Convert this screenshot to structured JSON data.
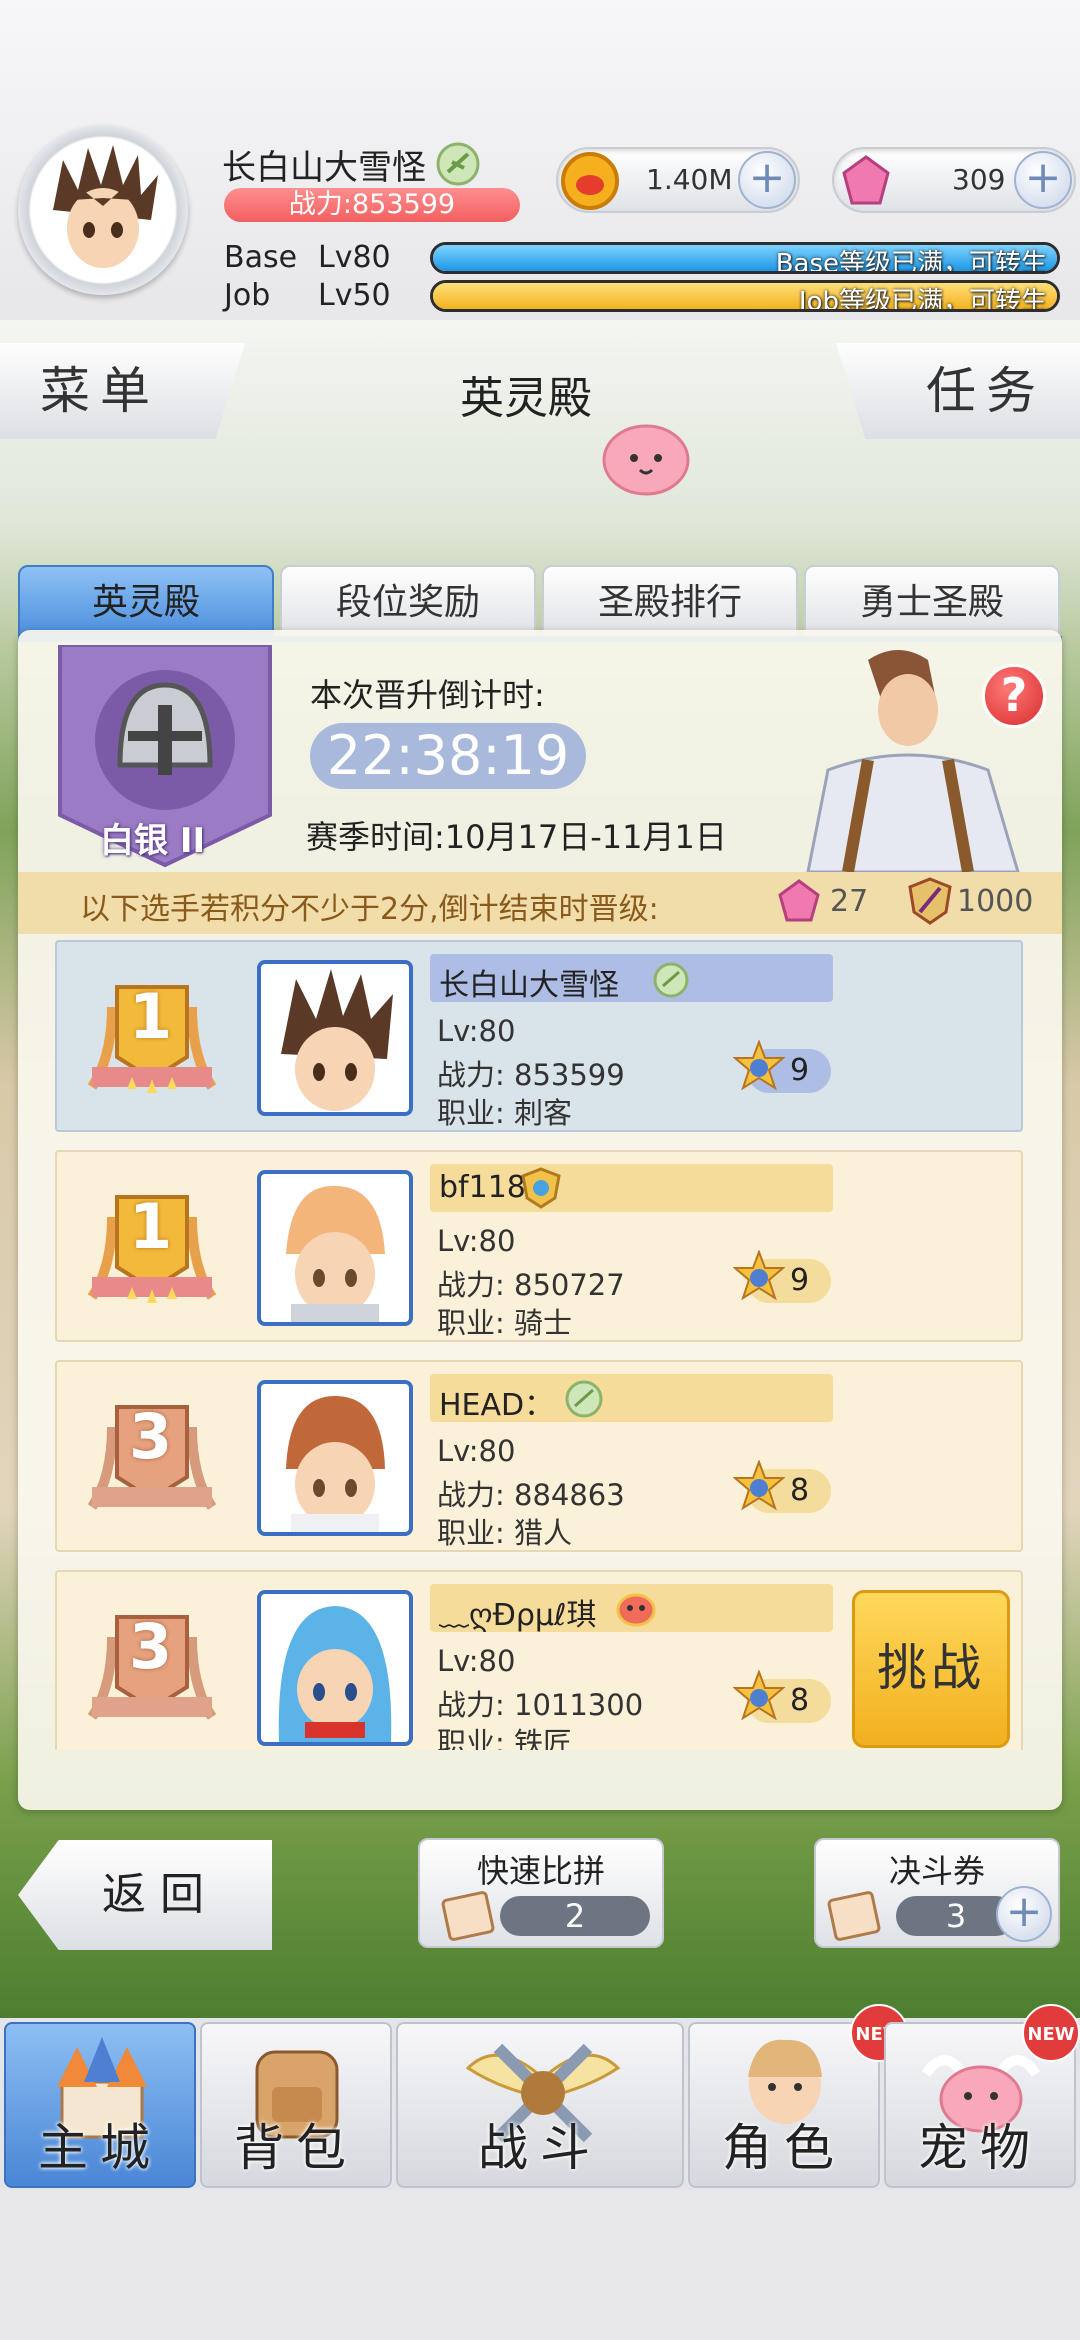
{
  "player": {
    "name": "长白山大雪怪",
    "power": "战力:853599",
    "base_label": "Base",
    "base_level": "Lv80",
    "base_status": "Base等级已满，可转生",
    "job_label": "Job",
    "job_level": "Lv50",
    "job_status": "Job等级已满，可转生"
  },
  "currency": {
    "zeny": "1.40M",
    "gems": "309"
  },
  "header": {
    "menu": "菜单",
    "title": "英灵殿",
    "tasks": "任务"
  },
  "tabs": [
    "英灵殿",
    "段位奖励",
    "圣殿排行",
    "勇士圣殿"
  ],
  "rank": {
    "tier": "白银 II",
    "countdown_label": "本次晋升倒计时:",
    "countdown": "22:38:19",
    "season": "赛季时间:10月17日-11月1日"
  },
  "promotion": {
    "text": "以下选手若积分不少于2分,倒计结束时晋级:",
    "gems": "27",
    "honor": "1000"
  },
  "players": [
    {
      "rank": "1",
      "name": "长白山大雪怪",
      "level": "Lv:80",
      "power": "战力: 853599",
      "job": "职业: 刺客",
      "stars": "9"
    },
    {
      "rank": "1",
      "name": "bf118",
      "level": "Lv:80",
      "power": "战力: 850727",
      "job": "职业: 骑士",
      "stars": "9"
    },
    {
      "rank": "3",
      "name": "HEAD：",
      "level": "Lv:80",
      "power": "战力: 884863",
      "job": "职业: 猎人",
      "stars": "8"
    },
    {
      "rank": "3",
      "name": "﹏ღĐρμℓ琪",
      "level": "Lv:80",
      "power": "战力: 1011300",
      "job": "职业: 铁匠",
      "stars": "8"
    }
  ],
  "actions": {
    "challenge": "挑战",
    "back": "返回",
    "quick_match_label": "快速比拼",
    "quick_match_count": "2",
    "duel_ticket_label": "决斗券",
    "duel_ticket_count": "3"
  },
  "nav": [
    {
      "label": "主城",
      "new": false
    },
    {
      "label": "背包",
      "new": false
    },
    {
      "label": "战斗",
      "new": false
    },
    {
      "label": "角色",
      "new": true
    },
    {
      "label": "宠物",
      "new": true
    }
  ],
  "new_badge": "NEW",
  "colors": {
    "accent_blue": "#4d8fdd",
    "power_red": "#f25f5f",
    "gold": "#f2b01e"
  }
}
